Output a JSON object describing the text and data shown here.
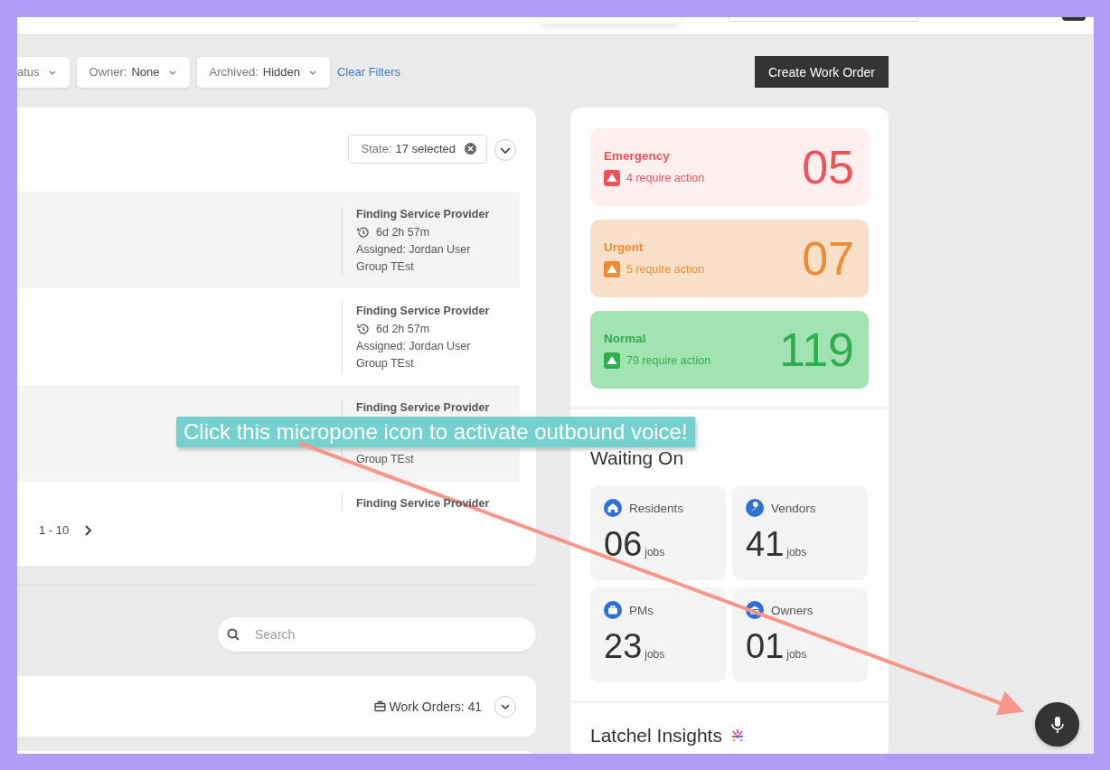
{
  "filters": [
    {
      "label": "atus"
    },
    {
      "label": "Owner:",
      "value": "None"
    },
    {
      "label": "Archived:",
      "value": "Hidden"
    }
  ],
  "clear_filters": "Clear Filters",
  "create_button": "Create Work Order",
  "state_filter": {
    "label": "State:",
    "value": "17 selected"
  },
  "rows": [
    {
      "status": "Finding Service Provider",
      "elapsed": "6d 2h 57m",
      "assigned": "Assigned: Jordan User",
      "group": "Group TEst"
    },
    {
      "status": "Finding Service Provider",
      "elapsed": "6d 2h 57m",
      "assigned": "Assigned: Jordan User",
      "group": "Group TEst"
    },
    {
      "status": "Finding Service Provider",
      "group": "Group TEst"
    },
    {
      "status": "Finding Service Provider"
    }
  ],
  "pagination": "1 - 10",
  "search": {
    "placeholder": "Search"
  },
  "work_orders_count": "Work Orders: 41",
  "priorities": [
    {
      "kind": "emergency",
      "label": "Emergency",
      "action": "4 require action",
      "count": "05"
    },
    {
      "kind": "urgent",
      "label": "Urgent",
      "action": "5 require action",
      "count": "07"
    },
    {
      "kind": "normal",
      "label": "Normal",
      "action": "79 require action",
      "count": "119"
    }
  ],
  "waiting_on": {
    "title": "Waiting On",
    "items": [
      {
        "kind": "home",
        "label": "Residents",
        "count": "06",
        "unit": "jobs"
      },
      {
        "kind": "wrench",
        "label": "Vendors",
        "count": "41",
        "unit": "jobs"
      },
      {
        "kind": "briefcase",
        "label": "PMs",
        "count": "23",
        "unit": "jobs"
      },
      {
        "kind": "bank",
        "label": "Owners",
        "count": "01",
        "unit": "jobs"
      }
    ]
  },
  "insights_title": "Latchel Insights",
  "callout": "Click this micropone icon to activate outbound voice!"
}
